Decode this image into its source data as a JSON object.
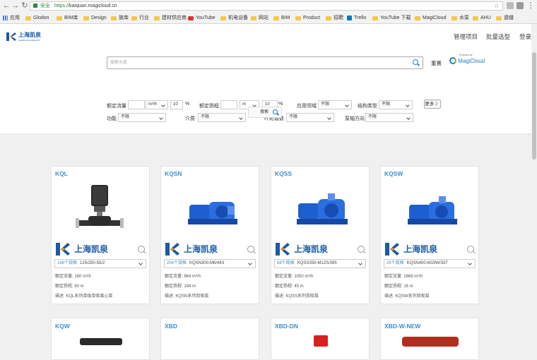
{
  "browser": {
    "secure_label": "安全",
    "url_scheme": "https://",
    "url_host": "kaiquan.magicloud.cn",
    "bookmarks": [
      {
        "label": "应用",
        "icon": "apps-icon"
      },
      {
        "label": "Glodon",
        "icon": "folder-icon"
      },
      {
        "label": "BIM库",
        "icon": "folder-icon"
      },
      {
        "label": "Design",
        "icon": "folder-icon"
      },
      {
        "label": "族库",
        "icon": "folder-icon"
      },
      {
        "label": "行业",
        "icon": "folder-icon"
      },
      {
        "label": "建材供应商",
        "icon": "folder-icon"
      },
      {
        "label": "YouTube",
        "icon": "youtube-icon"
      },
      {
        "label": "机电设备",
        "icon": "folder-icon"
      },
      {
        "label": "网站",
        "icon": "folder-icon"
      },
      {
        "label": "BIM",
        "icon": "folder-icon"
      },
      {
        "label": "Product",
        "icon": "folder-icon"
      },
      {
        "label": "招聘",
        "icon": "folder-icon"
      },
      {
        "label": "Trello",
        "icon": "trello-icon"
      },
      {
        "label": "YouTube 下载",
        "icon": "folder-icon"
      },
      {
        "label": "MagiCloud",
        "icon": "folder-icon"
      },
      {
        "label": "水泵",
        "icon": "folder-icon"
      },
      {
        "label": "AHU",
        "icon": "folder-icon"
      },
      {
        "label": "遗缝",
        "icon": "folder-icon"
      }
    ]
  },
  "header": {
    "logo_text": "上海凯泉",
    "logo_sub": "SHANGHAI KAIQUAN",
    "nav": [
      "管理项目",
      "批量选型",
      "登录"
    ]
  },
  "filter": {
    "search_placeholder": "搜索水泵",
    "reset_label": "重置",
    "powered_by": "Powered by",
    "magicloud": "MagiCloud",
    "flow_label": "额定流量",
    "flow_unit": "m³/h",
    "flow_tol": "10",
    "percent": "%",
    "head_label": "额定扬程",
    "head_unit": "m",
    "head_tol": "10",
    "app_label": "应用领域",
    "struct_label": "结构类型",
    "func_label": "功能",
    "medium_label": "介质",
    "stage_label": "叶轮级数",
    "axis_label": "泵轴方向",
    "any": "不限",
    "more_label": "更多 〉",
    "search_btn": "搜索"
  },
  "products": [
    {
      "title": "KQL",
      "count": "166个规格",
      "model": "125/250-55/2",
      "flow": "额定流量: 160 m³/h",
      "head": "额定扬程: 80 m",
      "desc": "描述: KQL系列单级单吸离心泵"
    },
    {
      "title": "KQSN",
      "count": "204个规格",
      "model": "KQSN300-M6/443",
      "flow": "额定流量: 664 m³/h",
      "head": "额定扬程: 184 m",
      "desc": "描述: KQSN系列双吸泵"
    },
    {
      "title": "KQSS",
      "count": "68个规格",
      "model": "KQSS350-M12S/395",
      "flow": "额定流量: 1050 m³/h",
      "head": "额定扬程: 45 m",
      "desc": "描述: KQSS系列双吸泵"
    },
    {
      "title": "KQSW",
      "count": "25个规格",
      "model": "KQSN400-M19W/337",
      "flow": "额定流量: 1868 m³/h",
      "head": "额定扬程: 16 m",
      "desc": "描述: KQSW系列双吸泵"
    }
  ],
  "products_row2": [
    "KQW",
    "XBD",
    "XBD-DN",
    "XBD-W-NEW"
  ],
  "colors": {
    "accent": "#3a8fd0",
    "brand": "#1a5aa8",
    "pump_blue": "#1e5fd0"
  }
}
